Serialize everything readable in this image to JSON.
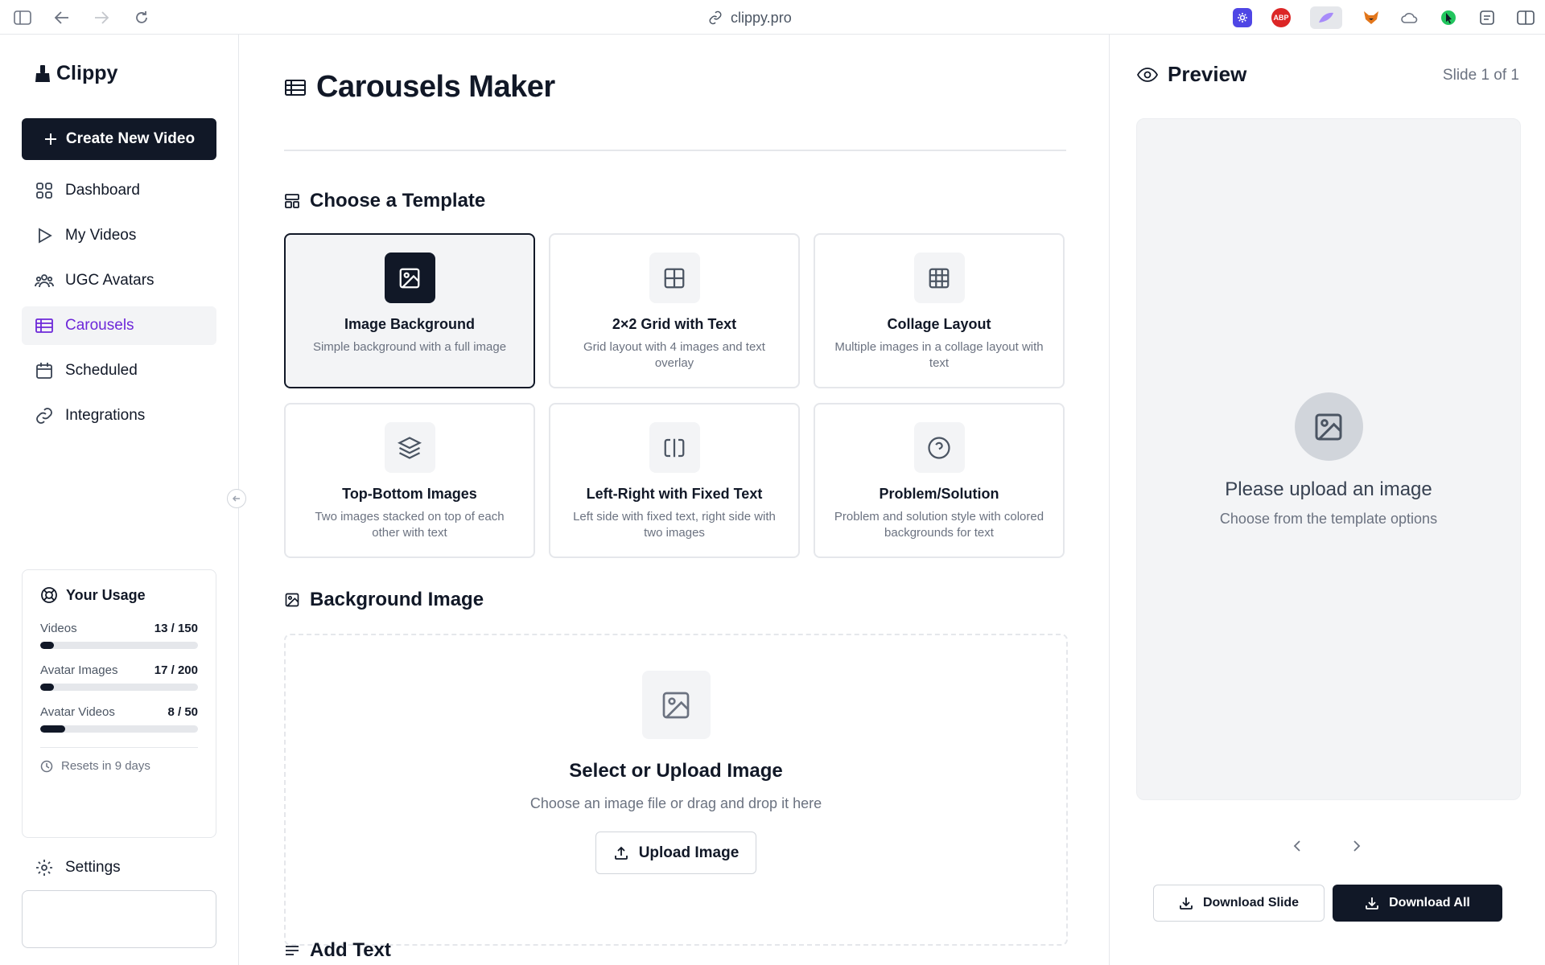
{
  "browser": {
    "url": "clippy.pro",
    "extensions": [
      "gear-extension-icon",
      "adblock-extension-icon",
      "feather-extension-icon",
      "fox-extension-icon",
      "cloud-extension-icon",
      "pointer-extension-icon",
      "notes-extension-icon"
    ],
    "abp_label": "ABP"
  },
  "sidebar": {
    "brand": "Clippy",
    "create_label": "Create New Video",
    "items": [
      {
        "label": "Dashboard",
        "icon": "grid-icon"
      },
      {
        "label": "My Videos",
        "icon": "play-icon"
      },
      {
        "label": "UGC Avatars",
        "icon": "users-icon"
      },
      {
        "label": "Carousels",
        "icon": "table-icon",
        "active": true
      },
      {
        "label": "Scheduled",
        "icon": "calendar-icon"
      },
      {
        "label": "Integrations",
        "icon": "link-icon"
      }
    ],
    "usage": {
      "title": "Your Usage",
      "rows": [
        {
          "label": "Videos",
          "count": "13 / 150",
          "fraction": 0.087
        },
        {
          "label": "Avatar Images",
          "count": "17 / 200",
          "fraction": 0.085
        },
        {
          "label": "Avatar Videos",
          "count": "8 / 50",
          "fraction": 0.16
        }
      ],
      "reset": "Resets in 9 days"
    },
    "settings_label": "Settings"
  },
  "main": {
    "title": "Carousels Maker",
    "template_section": "Choose a Template",
    "templates": [
      {
        "title": "Image Background",
        "desc": "Simple background with a full image",
        "icon": "image-icon",
        "selected": true
      },
      {
        "title": "2×2 Grid with Text",
        "desc": "Grid layout with 4 images and text overlay",
        "icon": "grid-2x2-icon"
      },
      {
        "title": "Collage Layout",
        "desc": "Multiple images in a collage layout with text",
        "icon": "grid-3x3-icon"
      },
      {
        "title": "Top-Bottom Images",
        "desc": "Two images stacked on top of each other with text",
        "icon": "layers-icon"
      },
      {
        "title": "Left-Right with Fixed Text",
        "desc": "Left side with fixed text, right side with two images",
        "icon": "split-icon"
      },
      {
        "title": "Problem/Solution",
        "desc": "Problem and solution style with colored backgrounds for text",
        "icon": "help-circle-icon"
      }
    ],
    "background_section": "Background Image",
    "upload": {
      "title": "Select or Upload Image",
      "subtitle": "Choose an image file or drag and drop it here",
      "button": "Upload Image"
    },
    "text_section": "Add Text"
  },
  "preview": {
    "title": "Preview",
    "slide_counter": "Slide 1 of 1",
    "empty_title": "Please upload an image",
    "empty_sub": "Choose from the template options",
    "download_slide": "Download Slide",
    "download_all": "Download All"
  }
}
